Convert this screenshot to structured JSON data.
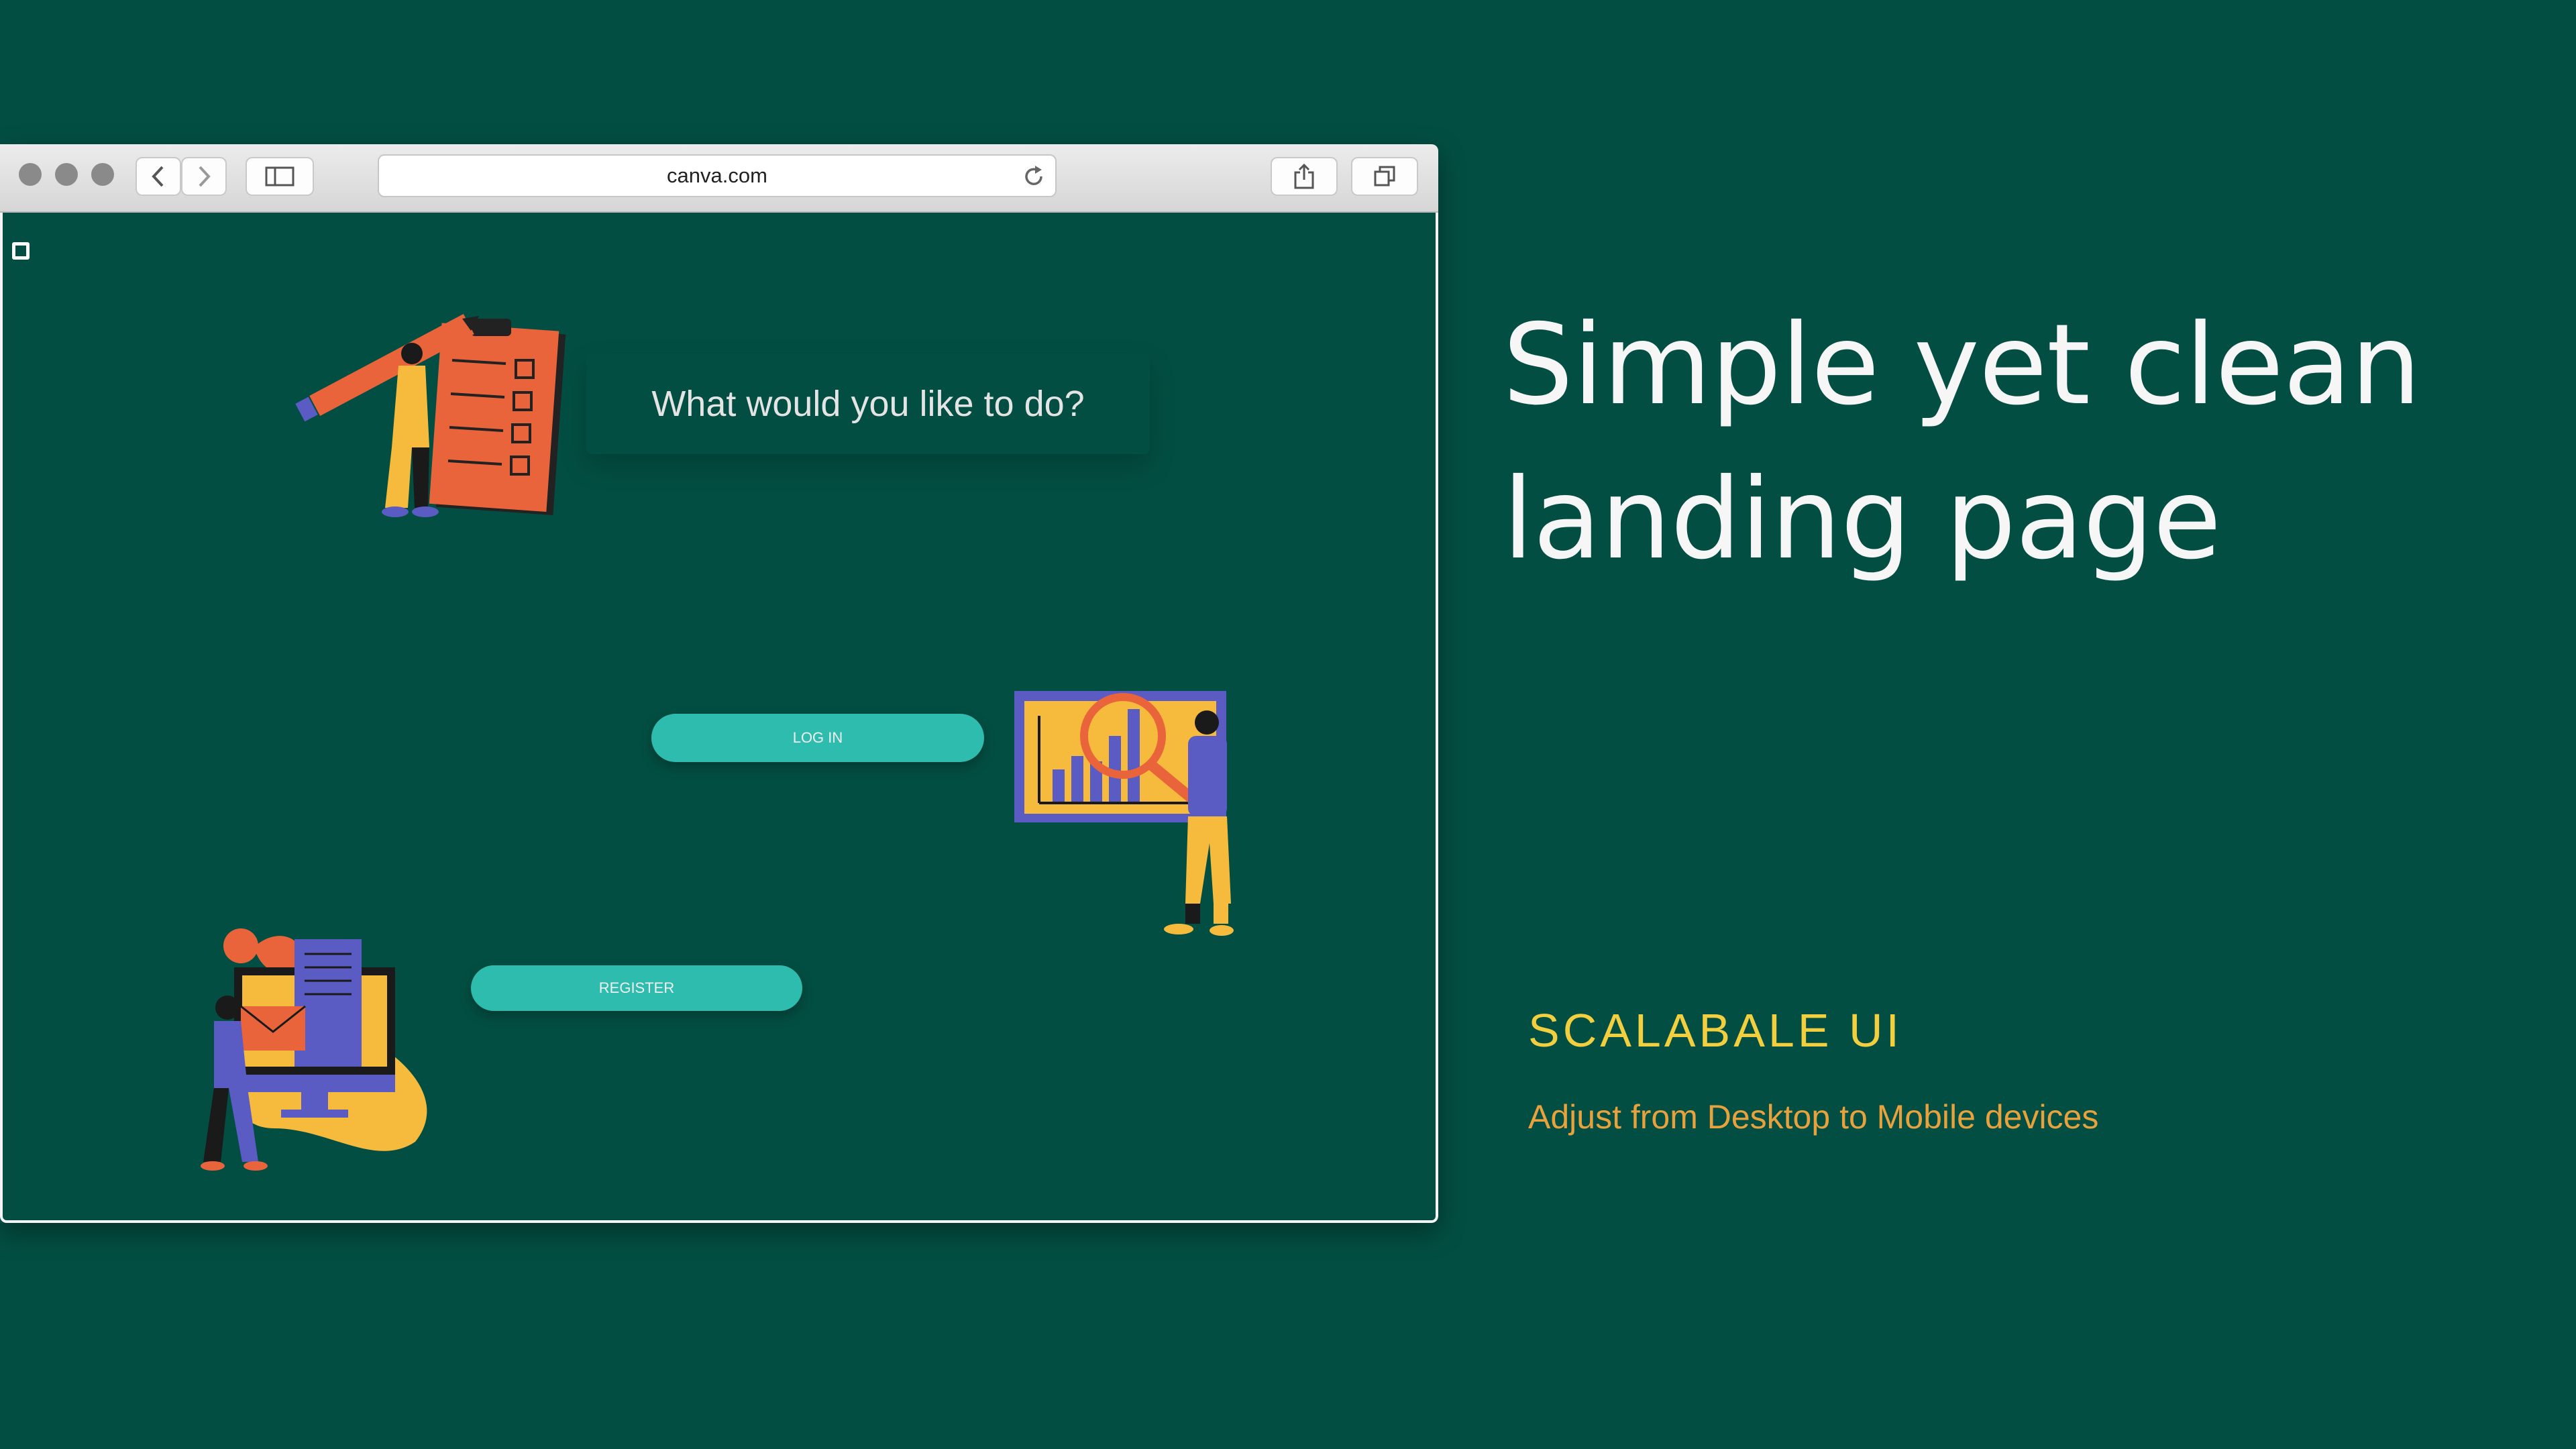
{
  "browser": {
    "url": "canva.com",
    "icons": {
      "close": "window-close-dot",
      "minimize": "window-minimize-dot",
      "zoom": "window-zoom-dot",
      "back": "chevron-left-icon",
      "forward": "chevron-right-icon",
      "sidebar": "sidebar-icon",
      "reload": "reload-icon",
      "share": "share-icon",
      "tabs": "tabs-icon"
    }
  },
  "page": {
    "question": "What would you like to do?",
    "login_label": "LOG IN",
    "register_label": "REGISTER",
    "menu_icon": "menu-square-icon"
  },
  "promo": {
    "headline_line1": "Simple yet clean",
    "headline_line2": "landing page",
    "subtitle": "SCALABALE UI",
    "description": "Adjust from Desktop to Mobile devices"
  },
  "colors": {
    "background": "#034e42",
    "button": "#2dbcad",
    "subtitle": "#f2cf3f",
    "description": "#e8a23d"
  }
}
